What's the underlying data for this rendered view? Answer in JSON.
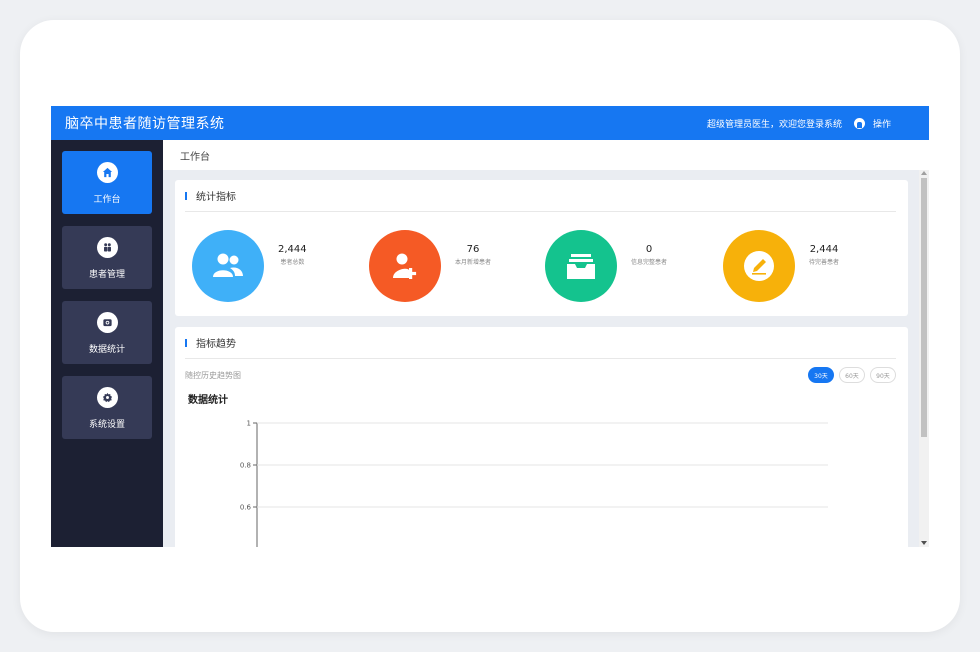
{
  "header": {
    "app_title": "脑卒中患者随访管理系统",
    "welcome": "超级管理员医生，欢迎您登录系统",
    "ops_label": "操作",
    "avatar_icon": "user-avatar-icon"
  },
  "sidebar": {
    "items": [
      {
        "label": "工作台",
        "icon": "home-icon",
        "active": true
      },
      {
        "label": "患者管理",
        "icon": "patients-icon",
        "active": false
      },
      {
        "label": "数据统计",
        "icon": "camera-icon",
        "active": false
      },
      {
        "label": "系统设置",
        "icon": "settings-icon",
        "active": false
      }
    ]
  },
  "breadcrumb": "工作台",
  "stats_panel": {
    "title": "统计指标",
    "items": [
      {
        "value": "2,444",
        "caption": "患者总数",
        "icon": "users-icon",
        "color": "#3fb0f8"
      },
      {
        "value": "76",
        "caption": "本月新增患者",
        "icon": "add-user-icon",
        "color": "#f55a25"
      },
      {
        "value": "0",
        "caption": "信息完整患者",
        "icon": "inbox-icon",
        "color": "#14c38e"
      },
      {
        "value": "2,444",
        "caption": "待完善患者",
        "icon": "edit-icon",
        "color": "#f7b10a"
      }
    ]
  },
  "trend_panel": {
    "title": "指标趋势",
    "subtitle": "随控历史趋势图",
    "ranges": [
      {
        "label": "30天",
        "active": true
      },
      {
        "label": "60天",
        "active": false
      },
      {
        "label": "90天",
        "active": false
      }
    ]
  },
  "chart_data": {
    "type": "line",
    "title": "数据统计",
    "xlabel": "",
    "ylabel": "",
    "y_ticks": [
      1,
      0.8,
      0.6
    ],
    "ylim": [
      0,
      1
    ],
    "grid": true,
    "series": []
  },
  "colors": {
    "accent": "#1677f2",
    "sidebar_bg": "#1c2033",
    "nav_item_bg": "#353a56"
  }
}
